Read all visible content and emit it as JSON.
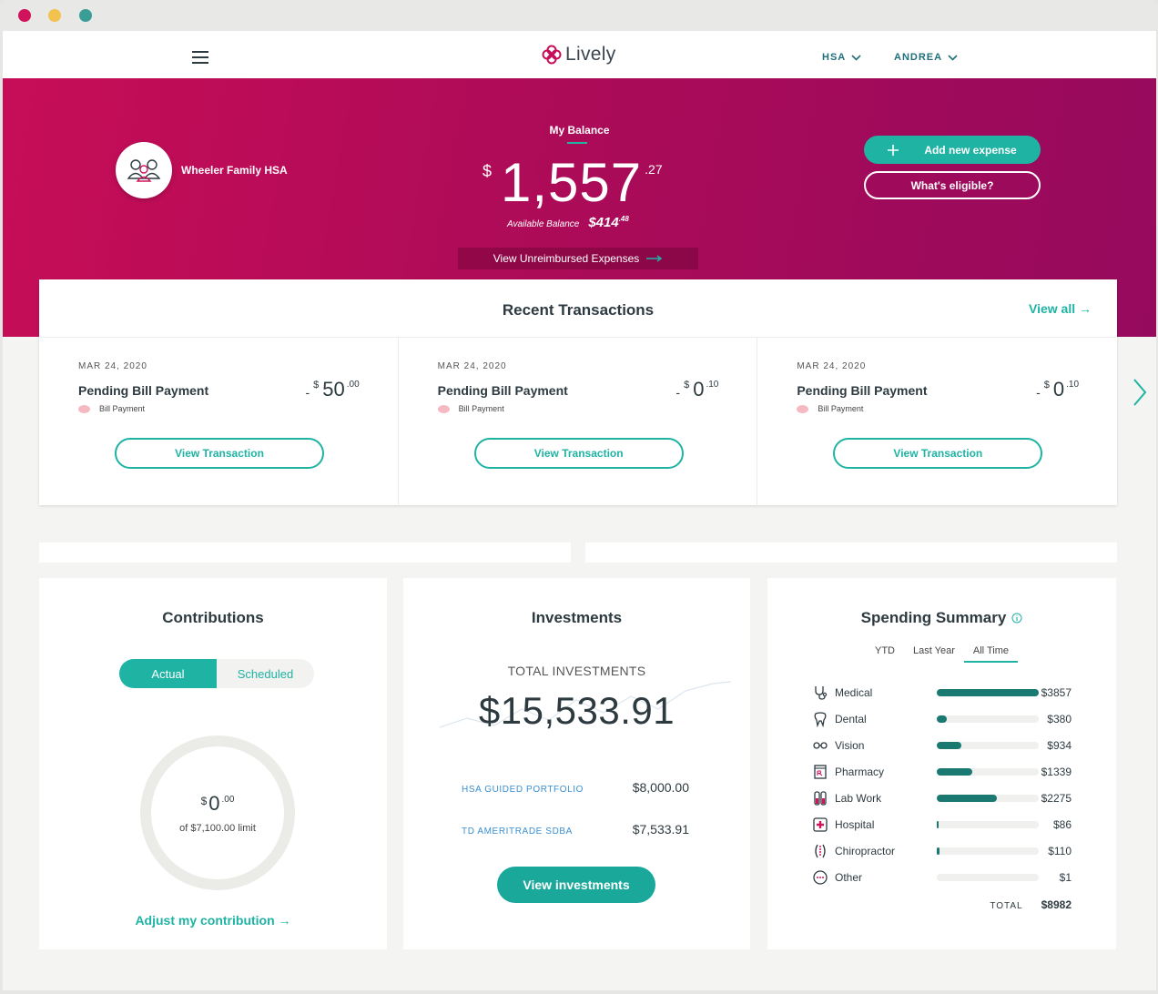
{
  "browser": {
    "dots": [
      "#d0145c",
      "#f2c14e",
      "#3a9e96"
    ]
  },
  "nav": {
    "logo": "Lively",
    "account_menu": "HSA",
    "user_menu": "ANDREA"
  },
  "hero": {
    "account_name": "Wheeler Family HSA",
    "balance_label": "My Balance",
    "balance_currency": "$",
    "balance_whole": "1,557",
    "balance_cents": ".27",
    "available_label": "Available Balance",
    "available_whole": "$414",
    "available_cents": ".48",
    "unreimbursed_label": "View Unreimbursed Expenses",
    "add_expense_label": "Add new expense",
    "eligible_label": "What's eligible?"
  },
  "recent": {
    "title": "Recent Transactions",
    "view_all": "View all →",
    "transactions": [
      {
        "date": "MAR 24, 2020",
        "title": "Pending Bill Payment",
        "minus": "-",
        "currency": "$",
        "whole": "50",
        "cents": ".00",
        "category": "Bill Payment",
        "button": "View Transaction"
      },
      {
        "date": "MAR 24, 2020",
        "title": "Pending Bill Payment",
        "minus": "-",
        "currency": "$",
        "whole": "0",
        "cents": ".10",
        "category": "Bill Payment",
        "button": "View Transaction"
      },
      {
        "date": "MAR 24, 2020",
        "title": "Pending Bill Payment",
        "minus": "-",
        "currency": "$",
        "whole": "0",
        "cents": ".10",
        "category": "Bill Payment",
        "button": "View Transaction"
      }
    ]
  },
  "contributions": {
    "title": "Contributions",
    "tab_actual": "Actual",
    "tab_scheduled": "Scheduled",
    "currency": "$",
    "whole": "0",
    "cents": ".00",
    "limit": "of $7,100.00 limit",
    "adjust": "Adjust my contribution →"
  },
  "investments": {
    "title": "Investments",
    "total_label": "TOTAL INVESTMENTS",
    "total": "$15,533.91",
    "rows": [
      {
        "name": "HSA GUIDED PORTFOLIO",
        "value": "$8,000.00"
      },
      {
        "name": "TD AMERITRADE SDBA",
        "value": "$7,533.91"
      }
    ],
    "button": "View investments"
  },
  "spending": {
    "title": "Spending Summary",
    "tabs": [
      "YTD",
      "Last Year",
      "All Time"
    ],
    "active_tab": "All Time",
    "rows": [
      {
        "icon": "stethoscope-icon",
        "name": "Medical",
        "amount": "$3857",
        "fraction": 1.0
      },
      {
        "icon": "tooth-icon",
        "name": "Dental",
        "amount": "$380",
        "fraction": 0.1
      },
      {
        "icon": "glasses-icon",
        "name": "Vision",
        "amount": "$934",
        "fraction": 0.24
      },
      {
        "icon": "prescription-icon",
        "name": "Pharmacy",
        "amount": "$1339",
        "fraction": 0.35
      },
      {
        "icon": "test-tubes-icon",
        "name": "Lab Work",
        "amount": "$2275",
        "fraction": 0.59
      },
      {
        "icon": "hospital-cross-icon",
        "name": "Hospital",
        "amount": "$86",
        "fraction": 0.02
      },
      {
        "icon": "spine-icon",
        "name": "Chiropractor",
        "amount": "$110",
        "fraction": 0.03
      },
      {
        "icon": "dots-circle-icon",
        "name": "Other",
        "amount": "$1",
        "fraction": 0.0
      }
    ],
    "total_label": "TOTAL",
    "total": "$8982",
    "bar_color": "#1a7a72"
  },
  "colors": {
    "accent": "#1fb3a4",
    "brand": "#c70d57"
  }
}
